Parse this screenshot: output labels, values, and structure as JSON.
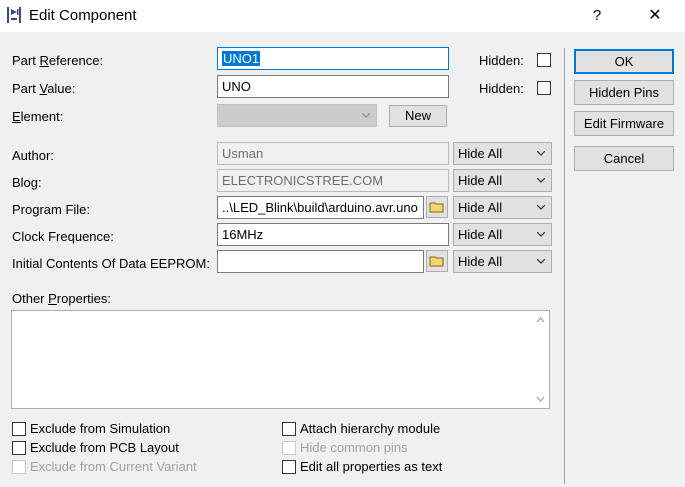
{
  "window": {
    "title": "Edit Component",
    "help_label": "?",
    "close_label": "✕"
  },
  "fields": {
    "part_reference": {
      "label": "Part Reference:",
      "value": "UNO1",
      "hidden_label": "Hidden:"
    },
    "part_value": {
      "label": "Part Value:",
      "value": "UNO",
      "hidden_label": "Hidden:"
    },
    "element": {
      "label": "Element:",
      "value": "",
      "new_label": "New"
    },
    "author": {
      "label": "Author:",
      "value": "Usman",
      "visibility": "Hide All"
    },
    "blog": {
      "label": "Blog:",
      "value": "ELECTRONICSTREE.COM",
      "visibility": "Hide All"
    },
    "program_file": {
      "label": "Program File:",
      "value": "..\\LED_Blink\\build\\arduino.avr.uno",
      "visibility": "Hide All"
    },
    "clock_frequence": {
      "label": "Clock Frequence:",
      "value": "16MHz",
      "visibility": "Hide All"
    },
    "eeprom": {
      "label": "Initial Contents Of Data EEPROM:",
      "value": "",
      "visibility": "Hide All"
    },
    "other_properties": {
      "label": "Other Properties:"
    }
  },
  "buttons": {
    "ok": "OK",
    "hidden_pins": "Hidden Pins",
    "edit_firmware": "Edit Firmware",
    "cancel": "Cancel"
  },
  "options": {
    "exclude_simulation": "Exclude from Simulation",
    "exclude_pcb": "Exclude from PCB Layout",
    "exclude_variant": "Exclude from Current Variant",
    "attach_hierarchy": "Attach hierarchy module",
    "hide_common_pins": "Hide common pins",
    "edit_as_text": "Edit all properties as text"
  },
  "icons": {
    "app": "component-icon",
    "browse": "folder-icon",
    "dropdown": "chevron-down-icon"
  },
  "colors": {
    "accent": "#0078d7",
    "background": "#f0f0f0"
  }
}
